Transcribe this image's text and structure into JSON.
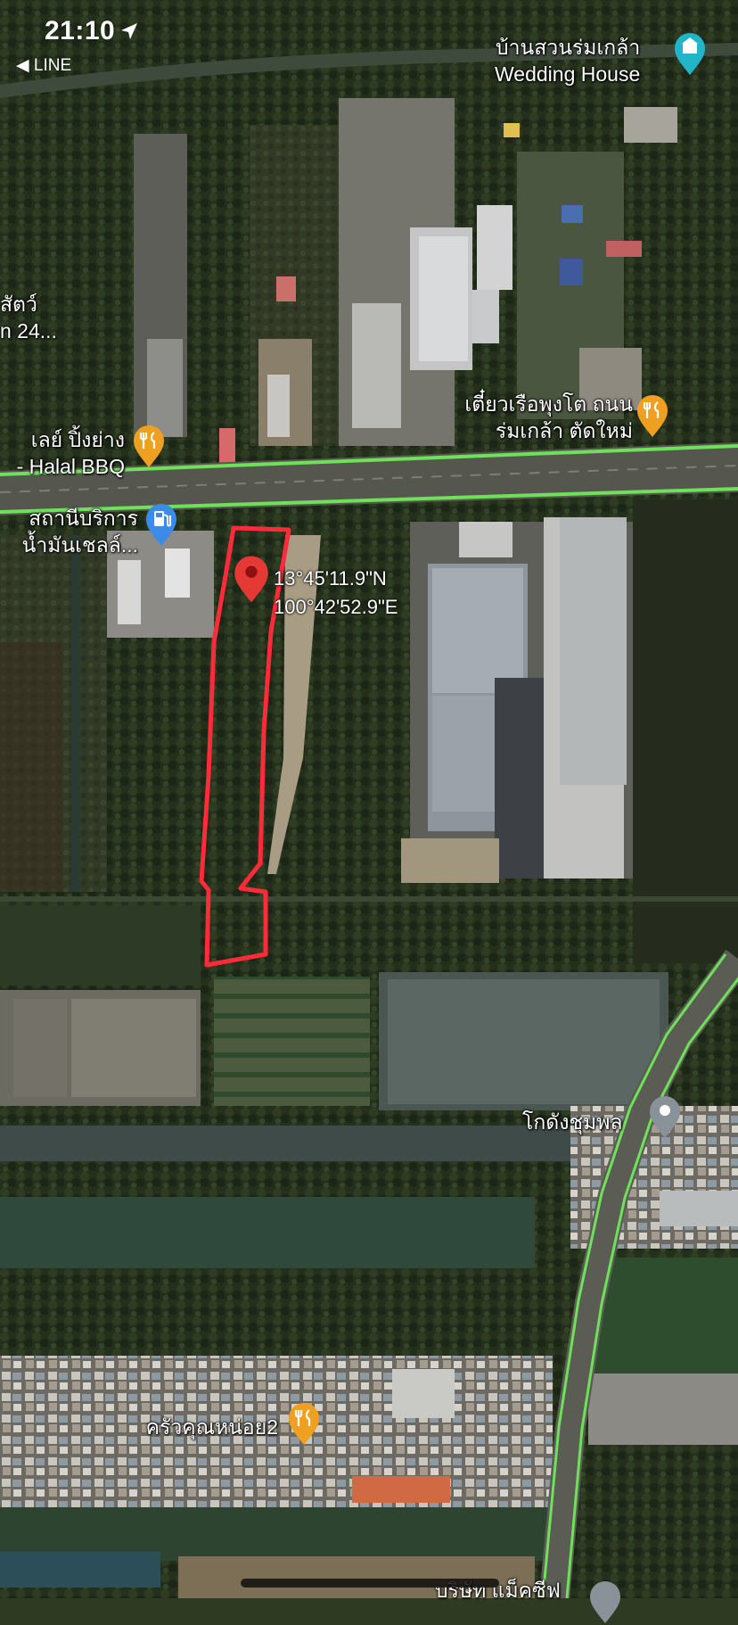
{
  "status_bar": {
    "time": "21:10",
    "back_label": "◀ LINE",
    "location_icon": "location-arrow-icon"
  },
  "places": {
    "wedding_house_line1": "บ้านสวนร่มเกล้า",
    "wedding_house_line2": "Wedding House",
    "left_edge_line1": "สัตว์",
    "left_edge_line2": "n 24...",
    "bbq_line1": "เลย์ ปิ้งย่าง",
    "bbq_line2": "- Halal BBQ",
    "noodle_line1": "เตี๋ยวเรือพุงโต ถนน",
    "noodle_line2": "ร่มเกล้า ตัดใหม่",
    "gas_line1": "สถานีบริการ",
    "gas_line2": "น้ำมันเชลล์...",
    "warehouse": "โกดังชุมพล",
    "kitchen": "ครัวคุณหน่อย2",
    "bottom_cut": "บริษัท แม็คซีฟ"
  },
  "pin": {
    "lat": "13°45'11.9\"N",
    "lon": "100°42'52.9\"E"
  },
  "colors": {
    "road_highlight": "#6ee05a",
    "food_pin": "#f0a020",
    "gas_pin": "#3d8be8",
    "warehouse_pin": "#8a9299",
    "wedding_pin": "#22b4c8",
    "drop_pin": "#e53935",
    "boundary": "#ff2a3a"
  }
}
